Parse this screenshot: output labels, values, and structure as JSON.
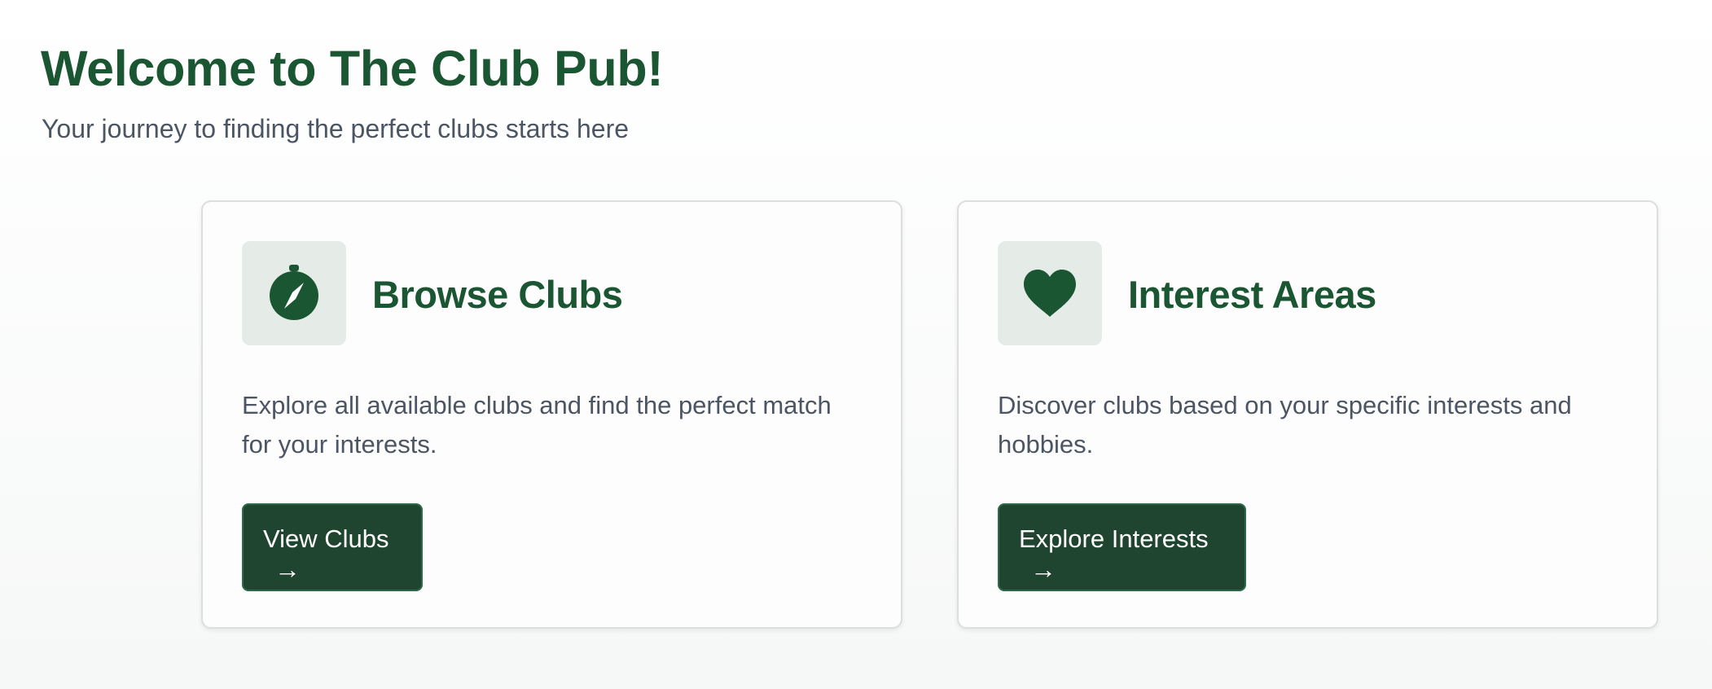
{
  "header": {
    "title": "Welcome to The Club Pub!",
    "subtitle": "Your journey to finding the perfect clubs starts here"
  },
  "cards": [
    {
      "icon": "compass-icon",
      "title": "Browse Clubs",
      "description": "Explore all available clubs and find the perfect match for your interests.",
      "button_label": "View Clubs",
      "button_arrow": "→"
    },
    {
      "icon": "heart-icon",
      "title": "Interest Areas",
      "description": "Discover clubs based on your specific interests and hobbies.",
      "button_label": "Explore Interests",
      "button_arrow": "→"
    }
  ],
  "colors": {
    "brand_green": "#1a5632",
    "button_bg": "#1f4530",
    "icon_tile_bg": "#e5ece8",
    "body_text": "#4b5563"
  }
}
